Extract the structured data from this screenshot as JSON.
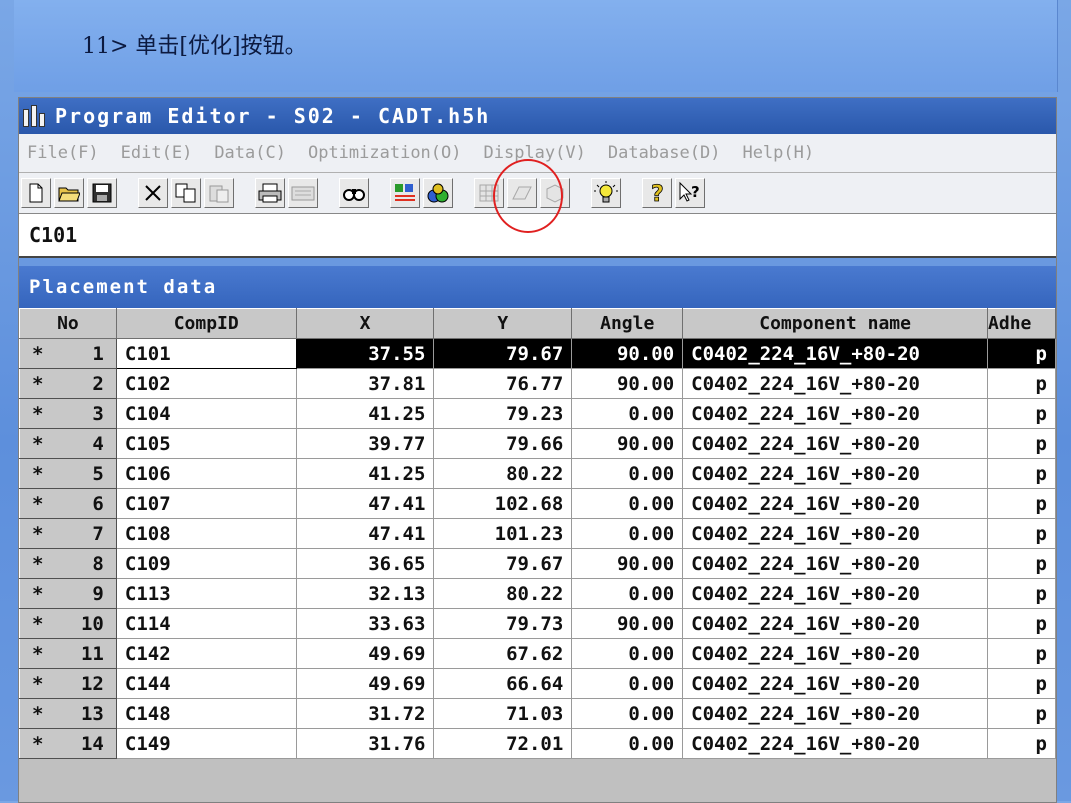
{
  "slide": {
    "caption": "11> 单击[优化]按钮。"
  },
  "window": {
    "title": "Program Editor - S02 - CADT.h5h"
  },
  "menu": [
    "File(F)",
    "Edit(E)",
    "Data(C)",
    "Optimization(O)",
    "Display(V)",
    "Database(D)",
    "Help(H)"
  ],
  "toolbar": {
    "icons": [
      "new-file-icon",
      "open-folder-icon",
      "save-icon",
      "cut-icon",
      "copy-icon",
      "paste-icon",
      "print-icon",
      "keyboard-icon",
      "binoculars-icon",
      "optimize-layers-icon",
      "optimize-icon",
      "grid-icon",
      "pcb-icon",
      "component-icon",
      "lightbulb-icon",
      "help-icon",
      "context-help-icon"
    ],
    "highlight": "optimize-icon",
    "highlight_color": "#e02020"
  },
  "current_component": "C101",
  "panel": {
    "title": "Placement data"
  },
  "columns": [
    "No",
    "CompID",
    "X",
    "Y",
    "Angle",
    "Component name",
    "Adhe"
  ],
  "rows": [
    {
      "marker": "*",
      "no": "1",
      "compid": "C101",
      "x": "37.55",
      "y": "79.67",
      "angle": "90.00",
      "name": "C0402_224_16V_+80-20",
      "adhe": "p"
    },
    {
      "marker": "*",
      "no": "2",
      "compid": "C102",
      "x": "37.81",
      "y": "76.77",
      "angle": "90.00",
      "name": "C0402_224_16V_+80-20",
      "adhe": "p"
    },
    {
      "marker": "*",
      "no": "3",
      "compid": "C104",
      "x": "41.25",
      "y": "79.23",
      "angle": "0.00",
      "name": "C0402_224_16V_+80-20",
      "adhe": "p"
    },
    {
      "marker": "*",
      "no": "4",
      "compid": "C105",
      "x": "39.77",
      "y": "79.66",
      "angle": "90.00",
      "name": "C0402_224_16V_+80-20",
      "adhe": "p"
    },
    {
      "marker": "*",
      "no": "5",
      "compid": "C106",
      "x": "41.25",
      "y": "80.22",
      "angle": "0.00",
      "name": "C0402_224_16V_+80-20",
      "adhe": "p"
    },
    {
      "marker": "*",
      "no": "6",
      "compid": "C107",
      "x": "47.41",
      "y": "102.68",
      "angle": "0.00",
      "name": "C0402_224_16V_+80-20",
      "adhe": "p"
    },
    {
      "marker": "*",
      "no": "7",
      "compid": "C108",
      "x": "47.41",
      "y": "101.23",
      "angle": "0.00",
      "name": "C0402_224_16V_+80-20",
      "adhe": "p"
    },
    {
      "marker": "*",
      "no": "8",
      "compid": "C109",
      "x": "36.65",
      "y": "79.67",
      "angle": "90.00",
      "name": "C0402_224_16V_+80-20",
      "adhe": "p"
    },
    {
      "marker": "*",
      "no": "9",
      "compid": "C113",
      "x": "32.13",
      "y": "80.22",
      "angle": "0.00",
      "name": "C0402_224_16V_+80-20",
      "adhe": "p"
    },
    {
      "marker": "*",
      "no": "10",
      "compid": "C114",
      "x": "33.63",
      "y": "79.73",
      "angle": "90.00",
      "name": "C0402_224_16V_+80-20",
      "adhe": "p"
    },
    {
      "marker": "*",
      "no": "11",
      "compid": "C142",
      "x": "49.69",
      "y": "67.62",
      "angle": "0.00",
      "name": "C0402_224_16V_+80-20",
      "adhe": "p"
    },
    {
      "marker": "*",
      "no": "12",
      "compid": "C144",
      "x": "49.69",
      "y": "66.64",
      "angle": "0.00",
      "name": "C0402_224_16V_+80-20",
      "adhe": "p"
    },
    {
      "marker": "*",
      "no": "13",
      "compid": "C148",
      "x": "31.72",
      "y": "71.03",
      "angle": "0.00",
      "name": "C0402_224_16V_+80-20",
      "adhe": "p"
    },
    {
      "marker": "*",
      "no": "14",
      "compid": "C149",
      "x": "31.76",
      "y": "72.01",
      "angle": "0.00",
      "name": "C0402_224_16V_+80-20",
      "adhe": "p"
    }
  ]
}
